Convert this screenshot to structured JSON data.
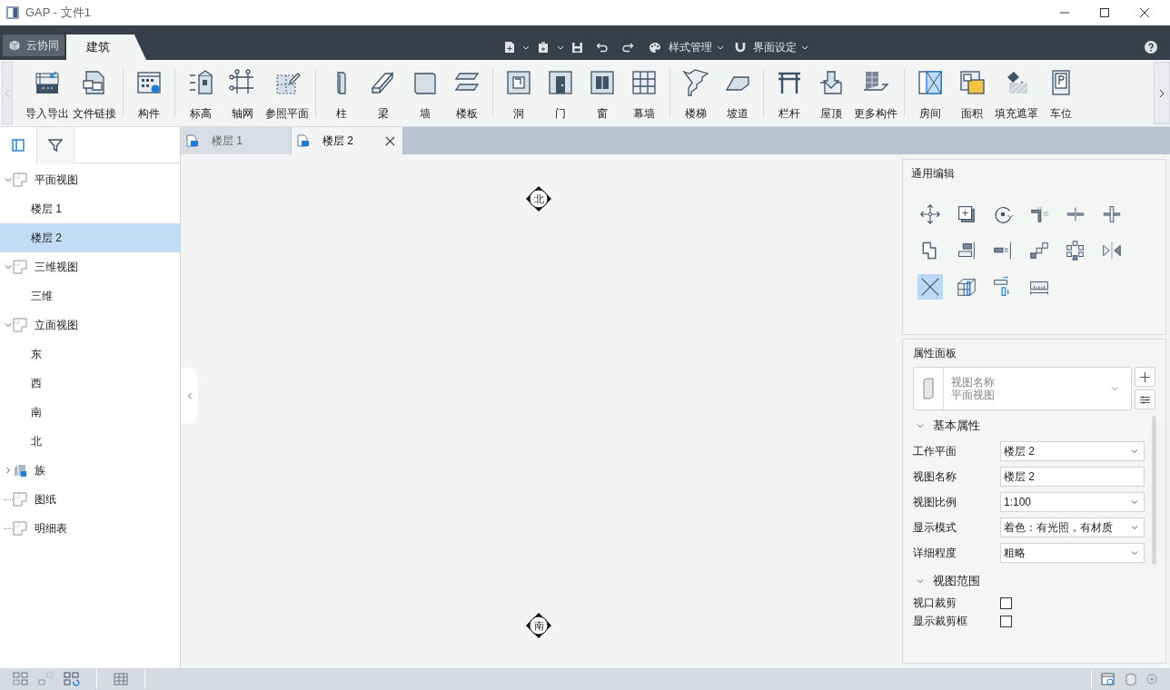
{
  "window": {
    "title": "GAP - 文件1"
  },
  "ribbon_tabs": [
    {
      "label": "云协同",
      "selected": false
    },
    {
      "label": "建筑",
      "selected": true
    }
  ],
  "quick_access": {
    "style_menu": "样式管理",
    "ui_menu": "界面设定"
  },
  "ribbon_groups": [
    {
      "buttons": [
        "导入导出",
        "文件链接"
      ]
    },
    {
      "buttons": [
        "构件"
      ]
    },
    {
      "buttons": [
        "标高",
        "轴网",
        "参照平面"
      ]
    },
    {
      "buttons": [
        "柱",
        "梁",
        "墙",
        "楼板"
      ]
    },
    {
      "buttons": [
        "洞",
        "门",
        "窗",
        "幕墙"
      ]
    },
    {
      "buttons": [
        "楼梯",
        "坡道"
      ]
    },
    {
      "buttons": [
        "栏杆",
        "屋顶",
        "更多构件"
      ]
    },
    {
      "buttons": [
        "房间",
        "面积",
        "填充遮罩",
        "车位"
      ]
    }
  ],
  "left_panel_tabs": [
    {
      "selected": true
    },
    {
      "selected": false
    }
  ],
  "tree": [
    {
      "label": "平面视图",
      "expanded": true,
      "selected": false,
      "children": [
        {
          "label": "楼层 1",
          "selected": false
        },
        {
          "label": "楼层 2",
          "selected": true
        }
      ]
    },
    {
      "label": "三维视图",
      "expanded": true,
      "selected": false,
      "children": [
        {
          "label": "三维",
          "selected": false
        }
      ]
    },
    {
      "label": "立面视图",
      "expanded": true,
      "selected": false,
      "children": [
        {
          "label": "东",
          "selected": false
        },
        {
          "label": "西",
          "selected": false
        },
        {
          "label": "南",
          "selected": false
        },
        {
          "label": "北",
          "selected": false
        }
      ]
    },
    {
      "label": "族",
      "expanded": false,
      "selected": false,
      "kind": "family"
    },
    {
      "label": "图纸",
      "selected": false
    },
    {
      "label": "明细表",
      "selected": false
    }
  ],
  "doc_tabs": [
    {
      "label": "楼层 1",
      "selected": false
    },
    {
      "label": "楼层 2",
      "selected": true
    }
  ],
  "canvas": {
    "north_marker": "北",
    "south_marker": "南"
  },
  "edit_panel": {
    "title": "通用编辑",
    "tools": [
      {
        "selected": false
      },
      {
        "selected": false
      },
      {
        "selected": false
      },
      {
        "selected": false
      },
      {
        "selected": false
      },
      {
        "selected": false
      },
      {
        "selected": false
      },
      {
        "selected": false
      },
      {
        "selected": false
      },
      {
        "selected": false
      },
      {
        "selected": false
      },
      {
        "selected": false
      },
      {
        "selected": true
      },
      {
        "selected": false
      },
      {
        "selected": false
      },
      {
        "selected": false
      }
    ]
  },
  "properties": {
    "title": "属性面板",
    "type_label": "视图名称",
    "type_value": "平面视图",
    "sections": [
      {
        "title": "基本属性",
        "expanded": true,
        "rows": [
          {
            "label": "工作平面",
            "value": "楼层 2",
            "kind": "select"
          },
          {
            "label": "视图名称",
            "value": "楼层 2",
            "kind": "text"
          },
          {
            "label": "视图比例",
            "value": "1:100",
            "kind": "select"
          },
          {
            "label": "显示模式",
            "value": "着色：有光照，有材质",
            "kind": "select"
          },
          {
            "label": "详细程度",
            "value": "粗略",
            "kind": "select"
          }
        ]
      },
      {
        "title": "视图范围",
        "expanded": true,
        "rows": [
          {
            "label": "视口裁剪",
            "checked": false,
            "kind": "checkbox"
          },
          {
            "label": "显示裁剪框",
            "checked": false,
            "kind": "checkbox"
          }
        ]
      }
    ]
  }
}
